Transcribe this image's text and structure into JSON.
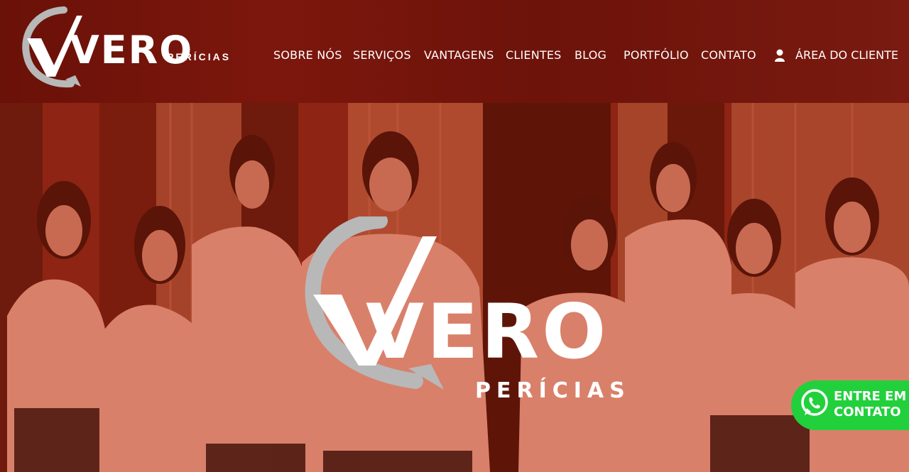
{
  "brand": {
    "name": "VERO",
    "tagline": "PERÍCIAS"
  },
  "nav": {
    "items": [
      {
        "label": "SOBRE NÓS"
      },
      {
        "label": "SERVIÇOS"
      },
      {
        "label": "VANTAGENS"
      },
      {
        "label": "CLIENTES"
      },
      {
        "label": "BLOG"
      },
      {
        "label": "PORTFÓLIO"
      },
      {
        "label": "CONTATO"
      }
    ],
    "client_area": {
      "label": "ÁREA DO CLIENTE",
      "icon": "user-icon"
    }
  },
  "hero": {
    "logo_word": "VERO",
    "logo_sub": "PERÍCIAS",
    "shirt_logo": "VERO"
  },
  "whatsapp": {
    "line1": "ENTRE EM",
    "line2": "CONTATO",
    "icon": "whatsapp-icon"
  },
  "colors": {
    "brand_red": "#7c170d",
    "whatsapp_green": "#22d03c",
    "logo_gray": "#b8b8b8"
  }
}
